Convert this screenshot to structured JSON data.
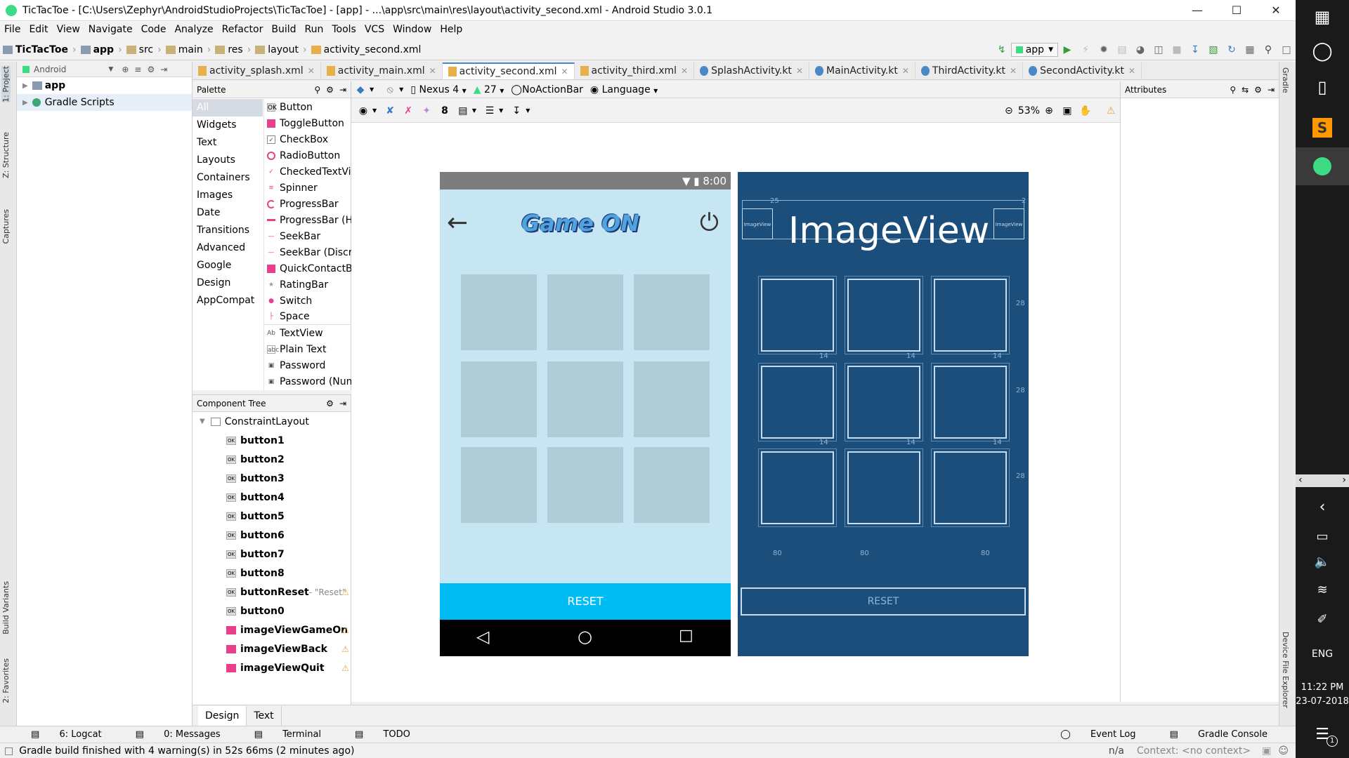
{
  "window": {
    "title": "TicTacToe - [C:\\Users\\Zephyr\\AndroidStudioProjects\\TicTacToe] - [app] - ...\\app\\src\\main\\res\\layout\\activity_second.xml - Android Studio 3.0.1"
  },
  "menu": [
    "File",
    "Edit",
    "View",
    "Navigate",
    "Code",
    "Analyze",
    "Refactor",
    "Build",
    "Run",
    "Tools",
    "VCS",
    "Window",
    "Help"
  ],
  "breadcrumb": [
    "TicTacToe",
    "app",
    "src",
    "main",
    "res",
    "layout",
    "activity_second.xml"
  ],
  "run_config": "app",
  "project_panel": {
    "view": "Android",
    "items": [
      "app",
      "Gradle Scripts"
    ]
  },
  "left_strip": [
    "1: Project",
    "Z: Structure",
    "Captures",
    "Build Variants",
    "2: Favorites"
  ],
  "right_strip": [
    "Gradle",
    "Device File Explorer"
  ],
  "editor_tabs": [
    {
      "label": "activity_splash.xml",
      "active": false
    },
    {
      "label": "activity_main.xml",
      "active": false
    },
    {
      "label": "activity_second.xml",
      "active": true
    },
    {
      "label": "activity_third.xml",
      "active": false
    },
    {
      "label": "SplashActivity.kt",
      "active": false
    },
    {
      "label": "MainActivity.kt",
      "active": false
    },
    {
      "label": "ThirdActivity.kt",
      "active": false
    },
    {
      "label": "SecondActivity.kt",
      "active": false
    }
  ],
  "palette": {
    "title": "Palette",
    "categories": [
      "All",
      "Widgets",
      "Text",
      "Layouts",
      "Containers",
      "Images",
      "Date",
      "Transitions",
      "Advanced",
      "Google",
      "Design",
      "AppCompat"
    ],
    "widgets": [
      "Button",
      "ToggleButton",
      "CheckBox",
      "RadioButton",
      "CheckedTextView",
      "Spinner",
      "ProgressBar",
      "ProgressBar (Horizontal)",
      "SeekBar",
      "SeekBar (Discrete)",
      "QuickContactBadge",
      "RatingBar",
      "Switch",
      "Space",
      "TextView",
      "Plain Text",
      "Password",
      "Password (Numeric)"
    ]
  },
  "component_tree": {
    "title": "Component Tree",
    "root": "ConstraintLayout",
    "items": [
      {
        "name": "button1",
        "type": "button"
      },
      {
        "name": "button2",
        "type": "button"
      },
      {
        "name": "button3",
        "type": "button"
      },
      {
        "name": "button4",
        "type": "button"
      },
      {
        "name": "button5",
        "type": "button"
      },
      {
        "name": "button6",
        "type": "button"
      },
      {
        "name": "button7",
        "type": "button"
      },
      {
        "name": "button8",
        "type": "button"
      },
      {
        "name": "buttonReset",
        "type": "button",
        "suffix": " - \"Reset\"",
        "warn": true
      },
      {
        "name": "button0",
        "type": "button"
      },
      {
        "name": "imageViewGameOn",
        "type": "image",
        "warn": true
      },
      {
        "name": "imageViewBack",
        "type": "image",
        "warn": true
      },
      {
        "name": "imageViewQuit",
        "type": "image",
        "warn": true
      }
    ]
  },
  "design_toolbar": {
    "device": "Nexus 4",
    "api": "27",
    "theme": "NoActionBar",
    "language": "Language",
    "margin": "8",
    "zoom": "53%"
  },
  "attributes": {
    "title": "Attributes"
  },
  "preview": {
    "clock": "8:00",
    "logo_text": "Game ON",
    "reset_label": "RESET"
  },
  "blueprint": {
    "imageview_label": "ImageView",
    "small_label": "ImageView",
    "reset_label": "RESET",
    "margin_top": "25",
    "margin_right": "2",
    "row_gap": "14",
    "col_margin": "28",
    "bottom_margin": "80"
  },
  "bottom_tabs": [
    "Design",
    "Text"
  ],
  "tool_windows_left": [
    "6: Logcat",
    "0: Messages",
    "Terminal",
    "TODO"
  ],
  "tool_windows_right": [
    "Event Log",
    "Gradle Console"
  ],
  "status": {
    "message": "Gradle build finished with 4 warning(s) in 52s 66ms (2 minutes ago)",
    "position": "n/a",
    "context": "Context: <no context>"
  },
  "taskbar": {
    "lang": "ENG",
    "time": "11:22 PM",
    "date": "23-07-2018",
    "notif_count": "1"
  }
}
